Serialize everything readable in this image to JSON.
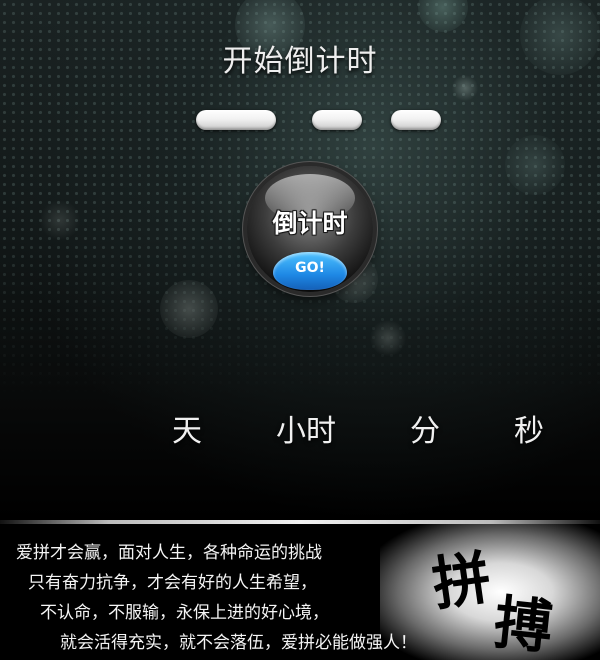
{
  "header": {
    "title": "开始倒计时"
  },
  "timer_fields": [
    {
      "value": ""
    },
    {
      "value": ""
    },
    {
      "value": ""
    }
  ],
  "countdown_button": {
    "label": "倒计时",
    "go_label": "GO!"
  },
  "units": {
    "day": "天",
    "hour": "小时",
    "minute": "分",
    "second": "秒"
  },
  "motto": {
    "lines": [
      "爱拼才会赢，面对人生，各种命运的挑战",
      "只有奋力抗争，才会有好的人生希望，",
      "不认命，不服输，永保上进的好心境，",
      "就会活得充实，就不会落伍，爱拼必能做强人！"
    ]
  },
  "calligraphy": {
    "char1": "拼",
    "char2": "搏"
  },
  "colors": {
    "accent": "#1e88e5",
    "text": "#f0f0f0",
    "background": "#000000"
  }
}
